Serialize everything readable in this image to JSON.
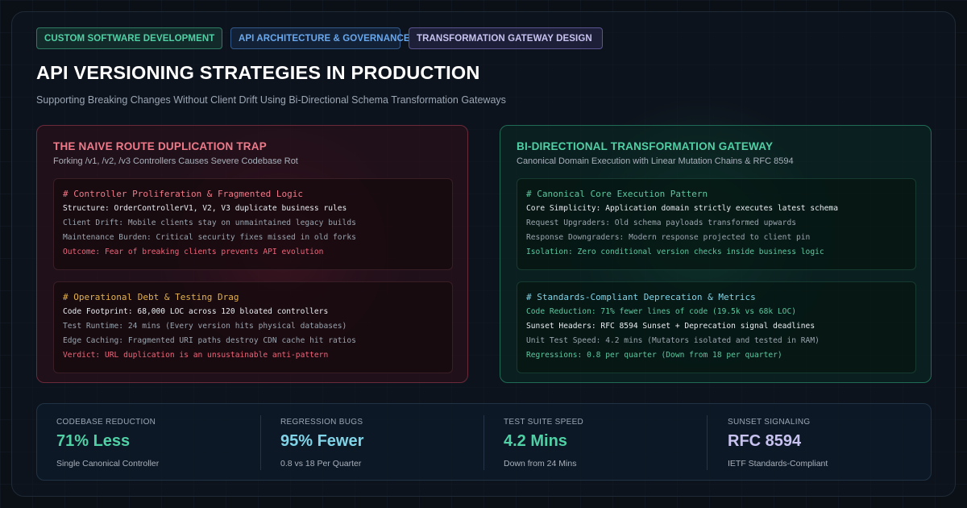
{
  "tags": [
    {
      "label": "CUSTOM SOFTWARE DEVELOPMENT"
    },
    {
      "label": "API ARCHITECTURE & GOVERNANCE"
    },
    {
      "label": "TRANSFORMATION GATEWAY DESIGN"
    }
  ],
  "header": {
    "title": "API VERSIONING STRATEGIES IN PRODUCTION",
    "subtitle": "Supporting Breaking Changes Without Client Drift Using Bi-Directional Schema Transformation Gateways"
  },
  "left_panel": {
    "title": "THE NAIVE ROUTE DUPLICATION TRAP",
    "subtitle": "Forking /v1, /v2, /v3 Controllers Causes Severe Codebase Rot",
    "boxes": [
      {
        "heading": "# Controller Proliferation & Fragmented Logic",
        "lines": [
          "Structure: OrderControllerV1, V2, V3 duplicate business rules",
          "Client Drift: Mobile clients stay on unmaintained legacy builds",
          "Maintenance Burden: Critical security fixes missed in old forks",
          "Outcome: Fear of breaking clients prevents API evolution"
        ]
      },
      {
        "heading": "# Operational Debt & Testing Drag",
        "lines": [
          "Code Footprint: 68,000 LOC across 120 bloated controllers",
          "Test Runtime: 24 mins (Every version hits physical databases)",
          "Edge Caching: Fragmented URI paths destroy CDN cache hit ratios",
          "Verdict: URL duplication is an unsustainable anti-pattern"
        ]
      }
    ]
  },
  "right_panel": {
    "title": "BI-DIRECTIONAL TRANSFORMATION GATEWAY",
    "subtitle": "Canonical Domain Execution with Linear Mutation Chains & RFC 8594",
    "boxes": [
      {
        "heading": "# Canonical Core Execution Pattern",
        "lines": [
          "Core Simplicity: Application domain strictly executes latest schema",
          "Request Upgraders: Old schema payloads transformed upwards",
          "Response Downgraders: Modern response projected to client pin",
          "Isolation: Zero conditional version checks inside business logic"
        ]
      },
      {
        "heading": "# Standards-Compliant Deprecation & Metrics",
        "lines": [
          "Code Reduction: 71% fewer lines of code (19.5k vs 68k LOC)",
          "Sunset Headers: RFC 8594 Sunset + Deprecation signal deadlines",
          "Unit Test Speed: 4.2 mins (Mutators isolated and tested in RAM)",
          "Regressions: 0.8 per quarter (Down from 18 per quarter)"
        ]
      }
    ]
  },
  "stats": [
    {
      "label": "CODEBASE REDUCTION",
      "value": "71% Less",
      "desc": "Single Canonical Controller",
      "color": "#4fd1a5"
    },
    {
      "label": "REGRESSION BUGS",
      "value": "95% Fewer",
      "desc": "0.8 vs 18 Per Quarter",
      "color": "#7fd4e8"
    },
    {
      "label": "TEST SUITE SPEED",
      "value": "4.2 Mins",
      "desc": "Down from 24 Mins",
      "color": "#4fd1a5"
    },
    {
      "label": "SUNSET SIGNALING",
      "value": "RFC 8594",
      "desc": "IETF Standards-Compliant",
      "color": "#c8c2f0"
    }
  ]
}
